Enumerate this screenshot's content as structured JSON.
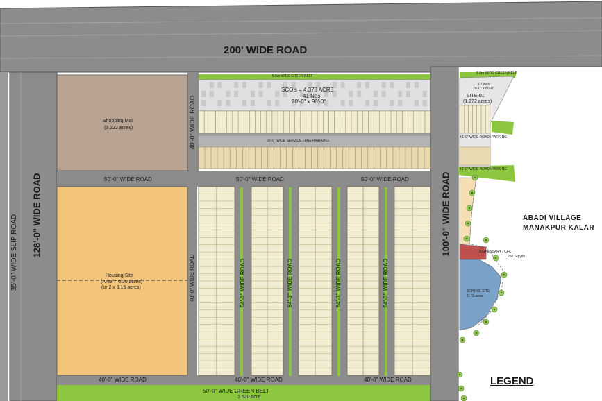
{
  "roads": {
    "top": "200' WIDE ROAD",
    "left_main": "128'-0\" WIDE ROAD",
    "left_slip": "35'-0\" WIDE SLIP ROAD",
    "right_main": "100'-0\" WIDE ROAD",
    "mall_side": "40'-0\" WIDE ROAD",
    "cross_50_left": "50'-0\" WIDE ROAD",
    "cross_50_mid": "50'-0\" WIDE ROAD",
    "cross_50_right": "50'-0\" WIDE ROAD",
    "housing_side": "40'-0\" WIDE ROAD",
    "inner_1": "54'-3\" WIDE ROAD",
    "inner_2": "54'-3\" WIDE ROAD",
    "inner_3": "54'-3\" WIDE ROAD",
    "inner_4": "54'-3\" WIDE ROAD",
    "bottom_left": "40'-0\" WIDE ROAD",
    "bottom_mid": "40'-0\" WIDE ROAD",
    "bottom_right": "40'-0\" WIDE ROAD",
    "service_lane": "35'-0\" WIDE SERVICE LANE+PARKING",
    "right_road_1": "41'-0\" WIDE ROAD+PARKING",
    "right_road_2": "41'-0\" WIDE ROAD+PARKING"
  },
  "belts": {
    "top_belt": "5.5m WIDE GREEN BELT",
    "right_belt": "5.0m WIDE GREEN BELT",
    "bottom_belt_line1": "50'-0\" WIDE GREEN BELT",
    "bottom_belt_line2": "1.520 acre"
  },
  "sco": {
    "line1": "SCO's = 4.378 ACRE",
    "line2": "41 Nos.",
    "line3": "20'-0\" x 90'-0\""
  },
  "mall": {
    "title": "Shopping Mall",
    "area": "(3.222 acres)"
  },
  "housing": {
    "title": "Housing Site",
    "area_line1": "(Area = 6.30 acres)",
    "area_line2": "(or 2 x 3.15 acres)"
  },
  "site01": {
    "count": "07 Nos.",
    "size": "20'-0\" x 80'-0\"",
    "title": "SITE-01",
    "area": "(1.272 acres)"
  },
  "village": {
    "line1": "ABADI VILLAGE",
    "line2": "MANAKPUR KALAR"
  },
  "dispensary": {
    "title": "DISPENSARY / CFC",
    "area": "250 Sq.yds"
  },
  "school": {
    "title": "SCHOOL SITE",
    "area": "0.73 acres"
  },
  "legend": "LEGEND",
  "colors": {
    "road": "#8c8c8c",
    "road_edge": "#5a5a5a",
    "green_belt": "#8cc63f",
    "housing": "#f3c57a",
    "mall": "#b9a392",
    "plot": "#f2ecd3",
    "sco_strip": "#e8d9b0",
    "school": "#7aa2c9",
    "dispensary": "#c0504d",
    "village_zone": "#f5deb3"
  },
  "icons": [
    "tree-icon"
  ]
}
